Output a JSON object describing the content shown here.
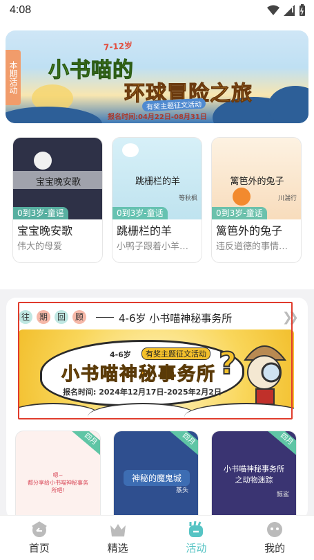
{
  "status_bar": {
    "time": "4:08"
  },
  "banner": {
    "tag": "本期活动",
    "age": "7-12岁",
    "title_line1": "小书喵的",
    "title_line2": "环球冒险之旅",
    "subtitle": "有奖主题征文活动",
    "date": "报名时间:04月22日-08月31日"
  },
  "books": [
    {
      "cover_title": "宝宝晚安歌",
      "cover_author": "",
      "tag": "0到3岁-童谣",
      "title": "宝宝晚安歌",
      "desc": "伟大的母爱",
      "cover_color": "#2e3147"
    },
    {
      "cover_title": "跳栅栏的羊",
      "cover_author": "等秋枫",
      "tag": "0到3岁-童话",
      "title": "跳栅栏的羊",
      "desc": "小鸭子跟着小羊…",
      "cover_color": "#cfeef6"
    },
    {
      "cover_title": "篱笆外的兔子",
      "cover_author": "川湍行",
      "tag": "0到3岁-童话",
      "title": "篱笆外的兔子",
      "desc": "违反道德的事情…",
      "cover_color": "#fbe7cf"
    }
  ],
  "past_review": {
    "chars": [
      "往",
      "期",
      "回",
      "顾"
    ],
    "title": "4-6岁 小书喵神秘事务所"
  },
  "event_banner": {
    "age": "4-6岁",
    "badge": "有奖主题征文活动",
    "title": "小书喵神秘事务所",
    "date": "报名时间: 2024年12月17日-2025年2月2日"
  },
  "mini_cards": [
    {
      "title": "嗯~\n都分享给小书喵神秘事务所吧!",
      "corner": "四月",
      "bg": "#fdf1ee"
    },
    {
      "title": "神秘的魔鬼城",
      "author": "蒸头",
      "corner": "四月",
      "bg": "#2f4f8f"
    },
    {
      "title": "小书喵神秘事务所之动物迷踪",
      "author": "鲸鲨",
      "corner": "四月",
      "bg": "#3a3472"
    }
  ],
  "tabs": [
    {
      "label": "首页",
      "icon": "home-icon"
    },
    {
      "label": "精选",
      "icon": "crown-icon"
    },
    {
      "label": "活动",
      "icon": "activity-icon",
      "active": true
    },
    {
      "label": "我的",
      "icon": "profile-icon"
    }
  ],
  "colors": {
    "accent": "#56c4c4",
    "highlight": "#e03b2c"
  }
}
